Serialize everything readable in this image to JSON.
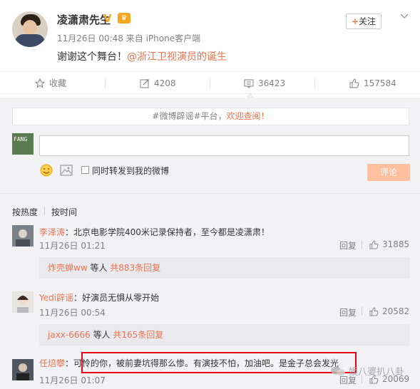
{
  "post": {
    "username": "凌潇肃先生",
    "vip_badge": "V",
    "meta": "11月26日 00:48 来自 iPhone客户端",
    "text": "谢谢这个舞台！",
    "mention": "@浙江卫视演员的诞生",
    "follow_label": "关注"
  },
  "actions": {
    "favorite": "收藏",
    "forward": "4208",
    "comment": "36423",
    "like": "157584"
  },
  "comments_section": {
    "notice_prefix": "#微博辟谣#平台，",
    "notice_highlight": "欢迎查阅！",
    "input_placeholder": "",
    "forward_label": "同时转发到我的微博",
    "submit_label": "评论",
    "sort_hot": "按热度",
    "sort_time": "按时间",
    "comments": [
      {
        "name": "李泽涛",
        "text": "：北京电影学院400米记录保持者，至今都是凌潇肃！",
        "time": "11月26日 01:21",
        "reply": "回复",
        "likes": "31885",
        "sub_name": "炸壳蝉ww",
        "sub_mid": " 等人 ",
        "sub_more": "共883条回复"
      },
      {
        "name": "Yedi辟谣",
        "text": "：好演员无惧从零开始",
        "time": "11月26日 00:54",
        "reply": "回复",
        "likes": "20582",
        "sub_name": "jaxx-6666",
        "sub_mid": " 等人 ",
        "sub_more": "共165条回复"
      },
      {
        "name": "任焙攀",
        "text": "：可怜的你，被前妻坑得那么惨。有演技不怕，加油吧。是金子总会发光",
        "time": "11月26日 01:07",
        "reply": "回复",
        "likes": "20069"
      }
    ]
  },
  "watermark": "娱八婆扒八卦",
  "colors": {
    "accent": "#eb7350",
    "submit_bg": "#ffc09f",
    "highlight_box": "#e60012",
    "panel_bg": "#f2f2f5"
  }
}
